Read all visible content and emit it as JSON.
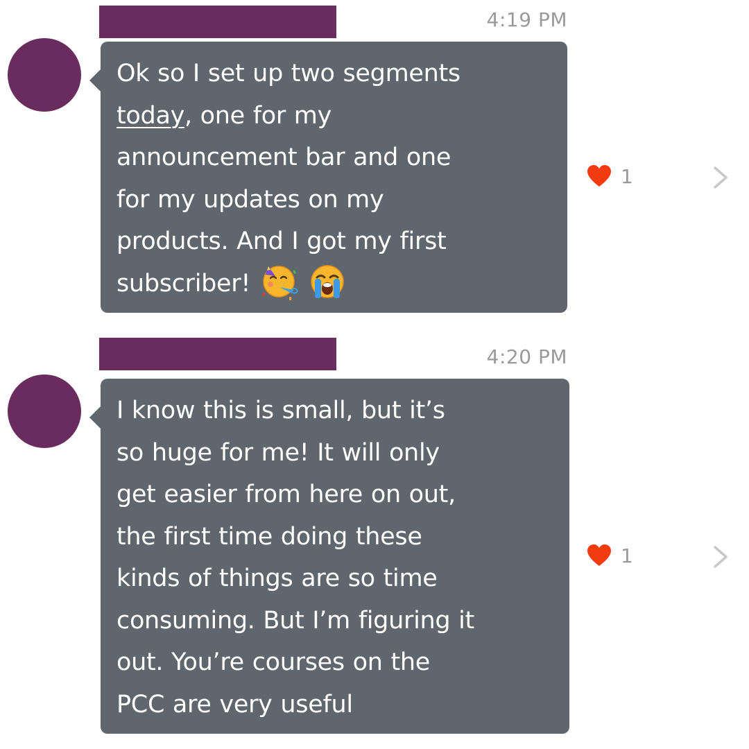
{
  "messages": [
    {
      "time": "4:19 PM",
      "lines": [
        "Ok so I set up two segments",
        "announcement bar and one",
        "for my updates on my",
        "products. And I got my first",
        "subscriber!"
      ],
      "underlined_word": "today",
      "line2_rest": ", one for my",
      "emojis": [
        "partying-face-emoji",
        "loudly-crying-face-emoji"
      ],
      "reaction": {
        "icon": "heart-icon",
        "count": "1",
        "color": "#f23b0f"
      }
    },
    {
      "time": "4:20 PM",
      "lines": [
        "I know this is small, but it’s",
        "so huge for me! It will only",
        "get easier from here on out,",
        "the first time doing these",
        "kinds of things are so time",
        "consuming. But I’m figuring it",
        "out. You’re courses on the",
        "PCC are very useful"
      ],
      "reaction": {
        "icon": "heart-icon",
        "count": "1",
        "color": "#f23b0f"
      }
    }
  ],
  "colors": {
    "name_redaction": "#6a2b5e",
    "avatar": "#6a2b5e",
    "bubble": "#5f666d",
    "bubble_text": "#ffffff",
    "meta_text": "#9a9a9a",
    "heart": "#f23b0f"
  }
}
